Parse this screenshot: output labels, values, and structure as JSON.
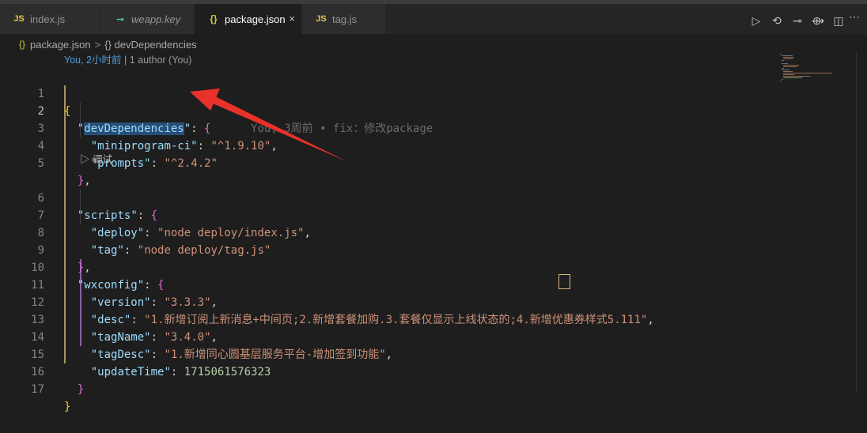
{
  "tabs": [
    {
      "label": "index.js",
      "icon": "js-file-icon",
      "active": false
    },
    {
      "label": "weapp.key",
      "icon": "key-icon",
      "active": false
    },
    {
      "label": "package.json",
      "icon": "json-file-icon",
      "active": true
    },
    {
      "label": "tag.js",
      "icon": "js-file-icon",
      "active": false
    }
  ],
  "active_tab_close": "×",
  "actions": [
    "run-icon",
    "compare-icon",
    "git-commit-icon",
    "git-next-icon",
    "split-editor-icon",
    "more-actions-icon"
  ],
  "breadcrumb": {
    "file": "package.json",
    "separator": ">",
    "symbol": "{} devDependencies"
  },
  "codelens": {
    "author_time": "You, 2小时前",
    "rest": " | 1 author (You)"
  },
  "inline_blame": "You, 3周前 • fix：修改package",
  "debug_lens": "▷ 调试",
  "lines": [
    {
      "n": "1"
    },
    {
      "n": "2"
    },
    {
      "n": "3"
    },
    {
      "n": "4"
    },
    {
      "n": "5"
    },
    {
      "n": "6"
    },
    {
      "n": "7"
    },
    {
      "n": "8"
    },
    {
      "n": "9"
    },
    {
      "n": "10"
    },
    {
      "n": "11"
    },
    {
      "n": "12"
    },
    {
      "n": "13"
    },
    {
      "n": "14"
    },
    {
      "n": "15"
    },
    {
      "n": "16"
    },
    {
      "n": "17"
    }
  ],
  "json": {
    "devDependencies_key": "devDependencies",
    "miniprogram_ci_key": "miniprogram-ci",
    "miniprogram_ci_val": "^1.9.10",
    "prompts_key": "prompts",
    "prompts_val": "^2.4.2",
    "scripts_key": "scripts",
    "deploy_key": "deploy",
    "deploy_val": "node deploy/index.js",
    "tag_key": "tag",
    "tag_val": "node deploy/tag.js",
    "wxconfig_key": "wxconfig",
    "version_key": "version",
    "version_val": "3.3.3",
    "desc_key": "desc",
    "desc_val_a": "1.新增订阅上新消息+中间页;2.新增套餐加购.3.套餐仅显示上线状态的",
    "desc_val_b": ";",
    "desc_val_c": "4.新增优惠券样式5.111",
    "tagName_key": "tagName",
    "tagName_val": "3.4.0",
    "tagDesc_key": "tagDesc",
    "tagDesc_val": "1.新增同心圆基层服务平台-增加签到功能",
    "updateTime_key": "updateTime",
    "updateTime_val": "1715061576323"
  },
  "colors": {
    "background": "#1e1e1e",
    "key": "#9cdcfe",
    "string": "#ce9178",
    "number": "#b5cea8",
    "bracket_gold": "#ffd700",
    "bracket_purple": "#da70d6",
    "annotation_arrow": "#e8312a"
  }
}
